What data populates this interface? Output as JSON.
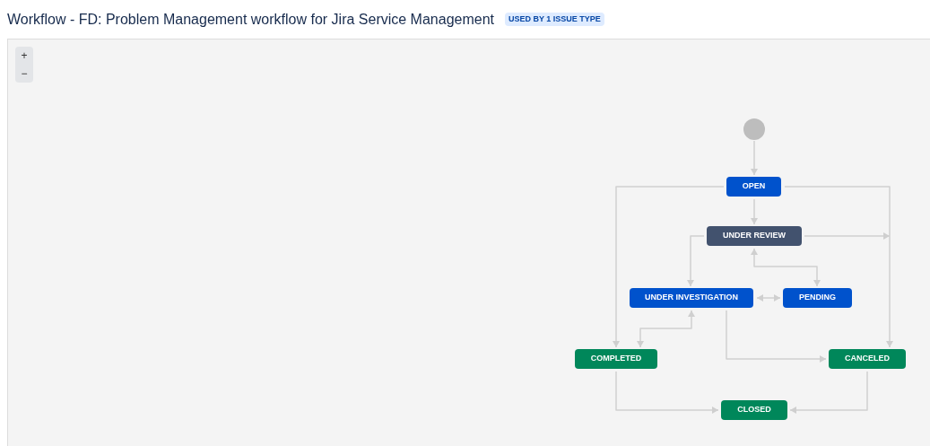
{
  "page": {
    "title": "Workflow - FD: Problem Management workflow for Jira Service Management",
    "badge": "USED BY 1 ISSUE TYPE"
  },
  "zoom_controls": [
    "+",
    "−"
  ],
  "statuses": [
    {
      "label": "OPEN",
      "color": "#0052cc"
    },
    {
      "label": "UNDER REVIEW",
      "color": "#42526e"
    },
    {
      "label": "UNDER INVESTIGATION",
      "color": "#0052cc"
    },
    {
      "label": "PENDING",
      "color": "#0052cc"
    },
    {
      "label": "COMPLETED",
      "color": "#00875a"
    },
    {
      "label": "CANCELED",
      "color": "#00875a"
    },
    {
      "label": "CLOSED",
      "color": "#00875a"
    }
  ]
}
